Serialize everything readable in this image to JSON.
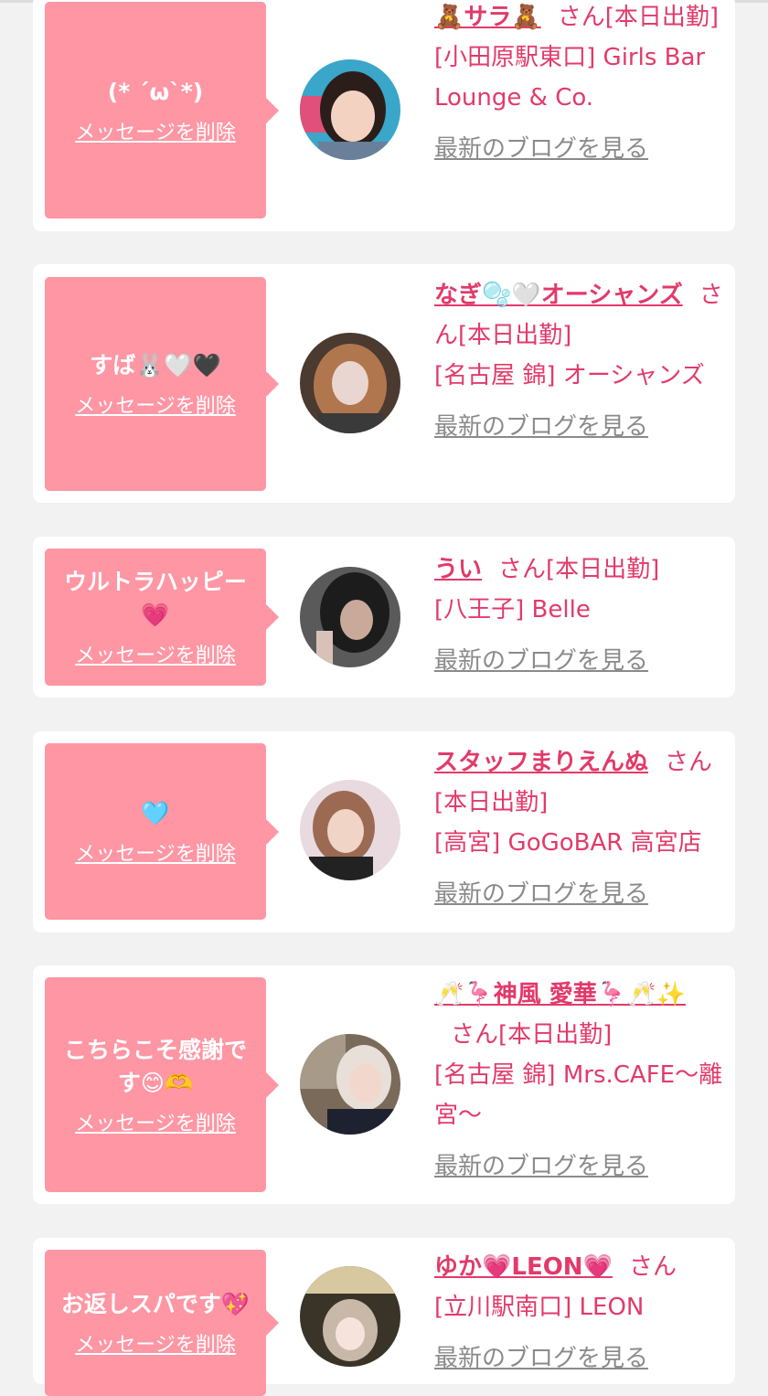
{
  "cards": [
    {
      "message": "(* ´ω`*)",
      "delete_label": "メッセージを削除",
      "name": "🧸サラ🧸",
      "status": "さん[本日出勤]",
      "shop": "[小田原駅東口] Girls Bar Lounge & Co.",
      "blog_label": "最新のブログを見る"
    },
    {
      "message": "すば🐰🤍🖤",
      "delete_label": "メッセージを削除",
      "name": "なぎ🫧🤍オーシャンズ",
      "status": "さん[本日出勤]",
      "shop": "[名古屋 錦] オーシャンズ",
      "blog_label": "最新のブログを見る"
    },
    {
      "message": "ウルトラハッピー💗",
      "delete_label": "メッセージを削除",
      "name": "うい",
      "status": "さん[本日出勤]",
      "shop": "[八王子] Belle",
      "blog_label": "最新のブログを見る"
    },
    {
      "message": "🩵",
      "delete_label": "メッセージを削除",
      "name": "スタッフまりえんぬ",
      "status": "さん[本日出勤]",
      "shop": "[高宮] GoGoBAR 高宮店",
      "blog_label": "最新のブログを見る"
    },
    {
      "message": "こちらこそ感謝です😊🫶",
      "delete_label": "メッセージを削除",
      "name": "🥂🦩神風 愛華🦩🥂✨",
      "status": "さん[本日出勤]",
      "shop": "[名古屋 錦] Mrs.CAFE〜離宮〜",
      "blog_label": "最新のブログを見る"
    },
    {
      "message": "お返しスパです💖",
      "delete_label": "メッセージを削除",
      "name": "ゆか💗LEON💗",
      "status": "さん",
      "shop": "[立川駅南口] LEON",
      "blog_label": "最新のブログを見る"
    }
  ],
  "colors": {
    "bubble": "#fe96a4",
    "name_text": "#e23a6a",
    "blog_link": "#8a8a8a",
    "background": "#f2f2f2"
  }
}
